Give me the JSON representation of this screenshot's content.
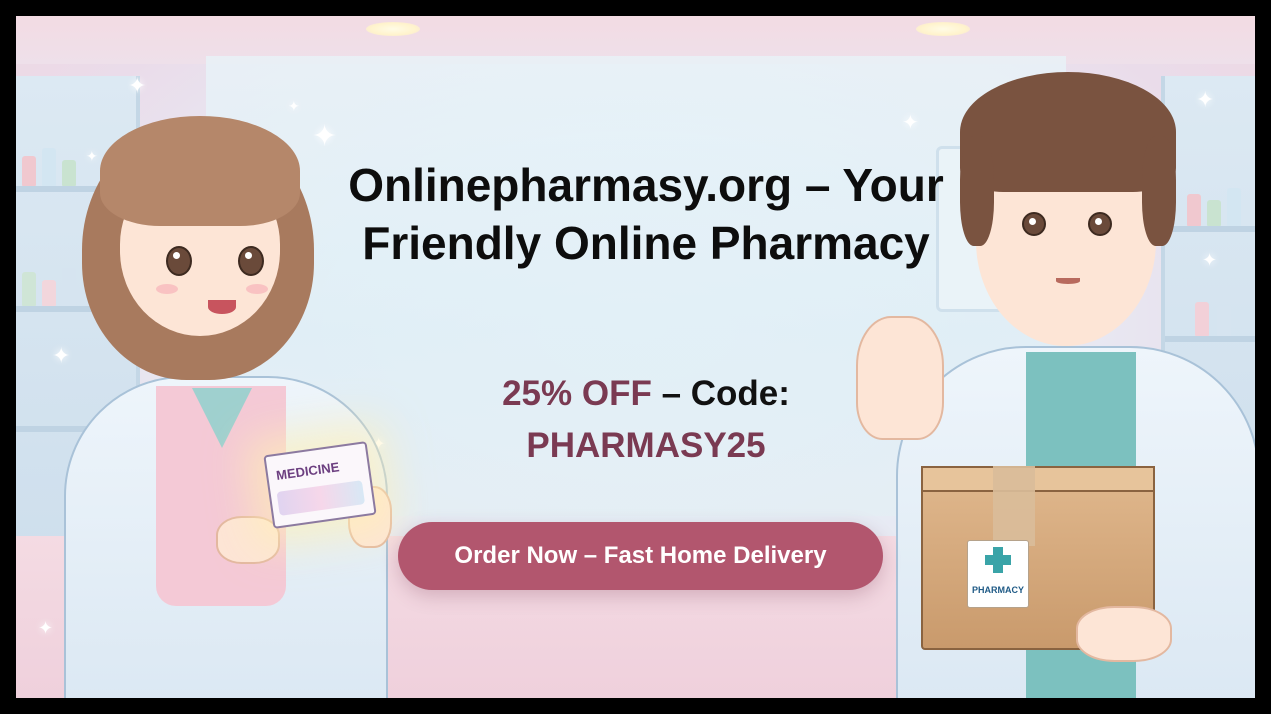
{
  "banner": {
    "headline": "Onlinepharmasy.org – Your Friendly Online Pharmacy",
    "discount": "25% OFF",
    "code_label": " – Code:",
    "code": "PHARMASY25",
    "cta_label": "Order Now – Fast Home Delivery"
  },
  "illustration": {
    "medicine_box_label": "MEDICINE",
    "parcel_label": "PHARMACY"
  },
  "colors": {
    "accent": "#7a3a52",
    "cta_background": "#b2566e",
    "headline_text": "#0d0d0d"
  }
}
